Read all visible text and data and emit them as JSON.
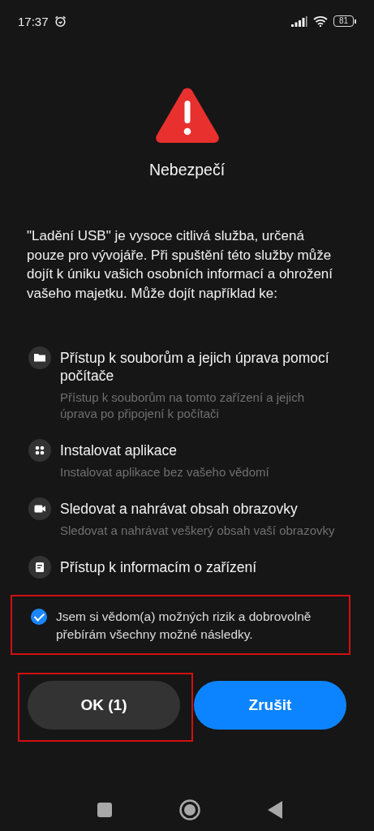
{
  "status_bar": {
    "time": "17:37",
    "battery": "81"
  },
  "dialog": {
    "title": "Nebezpečí",
    "message": "\"Ladění USB\" je vysoce citlivá služba, určená pouze pro vývojáře. Při spuštění této služby může dojít k úniku vašich osobních informací a ohrožení vašeho majetku. Může dojít například ke:",
    "permissions": [
      {
        "kind": "folder",
        "title": "Přístup k souborům a jejich úprava pomocí počítače",
        "description": "Přístup k souborům na tomto zařízení a jejich úprava po připojení k počítači"
      },
      {
        "kind": "apps",
        "title": "Instalovat aplikace",
        "description": "Instalovat aplikace bez vašeho vědomí"
      },
      {
        "kind": "camera",
        "title": "Sledovat a nahrávat obsah obrazovky",
        "description": "Sledovat a nahrávat veškerý obsah vaší obrazovky"
      },
      {
        "kind": "info",
        "title": "Přístup k informacím o zařízení"
      }
    ],
    "consent": {
      "text": "Jsem si vědom(a) možných rizik a dobrovolně přebírám všechny možné následky.",
      "checked": true,
      "highlighted": true
    },
    "buttons": [
      {
        "label": "OK (1)",
        "kind": "secondary",
        "highlighted": true
      },
      {
        "label": "Zrušit",
        "kind": "primary",
        "highlighted": false
      }
    ]
  }
}
